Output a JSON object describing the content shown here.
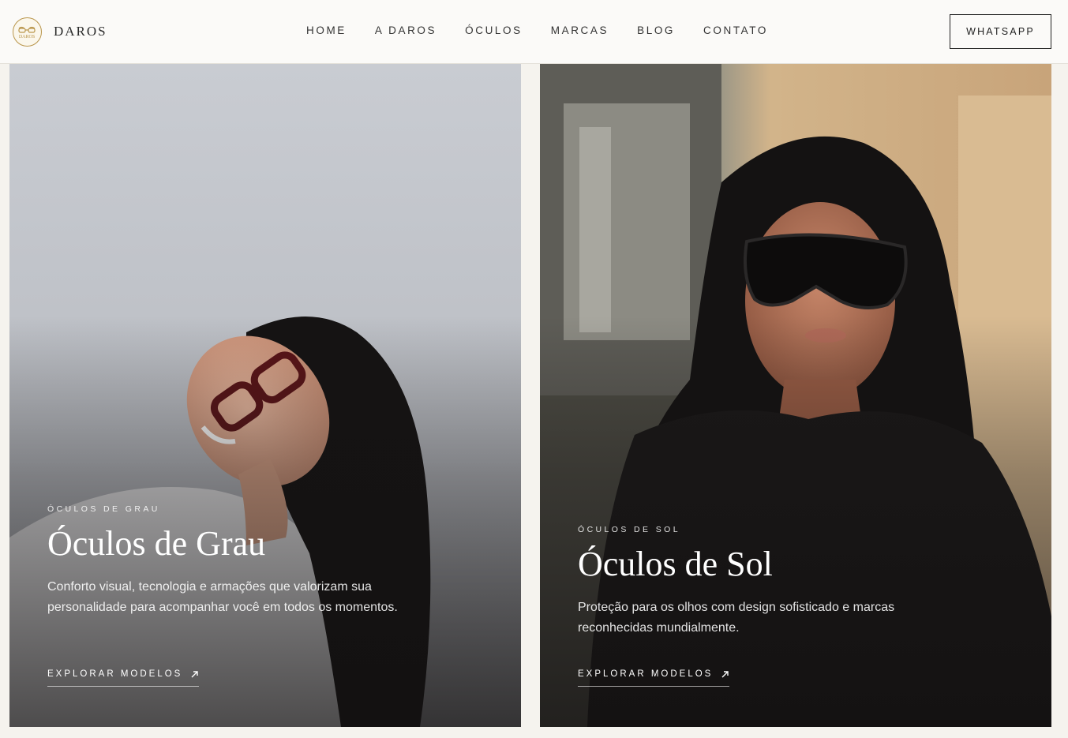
{
  "header": {
    "logo_mark_text": "DAROS",
    "logo_text": "DAROS",
    "nav": [
      "HOME",
      "A DAROS",
      "ÓCULOS",
      "MARCAS",
      "BLOG",
      "CONTATO"
    ],
    "cta_label": "WHATSAPP"
  },
  "cards": [
    {
      "eyebrow": "ÓCULOS DE GRAU",
      "title": "Óculos de Grau",
      "description": "Conforto visual, tecnologia e armações que valorizam sua personalidade para acompanhar você em todos os momentos.",
      "link_label": "EXPLORAR MODELOS",
      "link_icon": "arrow-up-right-icon"
    },
    {
      "eyebrow": "ÓCULOS DE SOL",
      "title": "Óculos de Sol",
      "description": "Proteção para os olhos com design sofisticado e marcas reconhecidas mundialmente.",
      "link_label": "EXPLORAR MODELOS",
      "link_icon": "arrow-up-right-icon"
    }
  ],
  "colors": {
    "page_bg": "#f5f3ee",
    "header_bg": "#fbfaf8",
    "logo_gold": "#b9954a",
    "text_dark": "#222222"
  }
}
